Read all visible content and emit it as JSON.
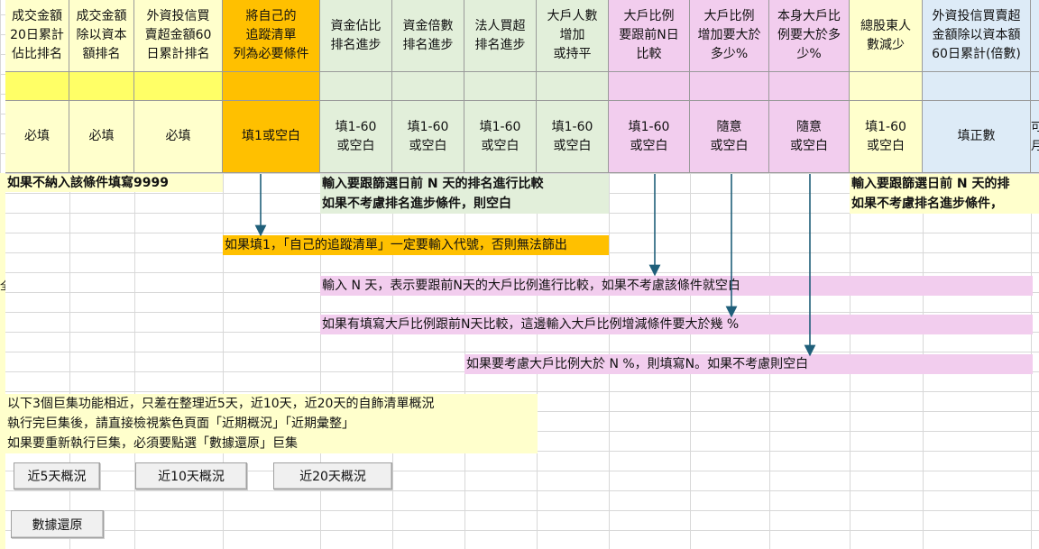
{
  "colors": {
    "yellow": "#ffff66",
    "yellow_light": "#ffffcc",
    "orange": "#ffc000",
    "green": "#e2efda",
    "pink": "#f2cdee",
    "blue": "#ddebf7",
    "arrow": "#1f5f7a"
  },
  "headers": [
    {
      "id": "h1",
      "title": "成交金額\n20日累計\n佔比排名",
      "req": "必填"
    },
    {
      "id": "h2",
      "title": "成交金額\n除以資本\n額排名",
      "req": "必填"
    },
    {
      "id": "h3",
      "title": "外資投信買\n賣超金額60\n日累計排名",
      "req": "必填"
    },
    {
      "id": "h4",
      "title": "將自己的\n追蹤清單\n列為必要條件",
      "req": "填1或空白"
    },
    {
      "id": "h5",
      "title": "資金佔比\n排名進步",
      "req": "填1-60\n或空白"
    },
    {
      "id": "h6",
      "title": "資金倍數\n排名進步",
      "req": "填1-60\n或空白"
    },
    {
      "id": "h7",
      "title": "法人買超\n排名進步",
      "req": "填1-60\n或空白"
    },
    {
      "id": "h8",
      "title": "大戶人數\n增加\n或持平",
      "req": "填1-60\n或空白"
    },
    {
      "id": "h9",
      "title": "大戶比例\n要跟前N日\n比較",
      "req": "填1-60\n或空白"
    },
    {
      "id": "h10",
      "title": "大戶比例\n增加要大於\n多少%",
      "req": "隨意\n或空白"
    },
    {
      "id": "h11",
      "title": "本身大戶比\n例要大於多\n少%",
      "req": "隨意\n或空白"
    },
    {
      "id": "h12",
      "title": "總股東人\n數減少",
      "req": "填1-60\n或空白"
    },
    {
      "id": "h13",
      "title": "外資投信買賣超\n金額除以資本額\n60日累計(倍數)",
      "req": "填正數"
    },
    {
      "id": "h14",
      "title": "",
      "req": "可\n月"
    }
  ],
  "notes": {
    "n1": "如果不納入該條件填寫9999",
    "n2a": "輸入要跟篩選日前 N 天的排名進行比較",
    "n2b": "如果不考慮排名進步條件，則空白",
    "n3a": "輸入要跟篩選日前 N 天的排",
    "n3b": "如果不考慮排名進步條件，",
    "n4": "如果填1，「自己的追蹤清單」一定要輸入代號，否則無法篩出",
    "n5": "輸入 N 天，表示要跟前N天的大戶比例進行比較，如果不考慮該條件就空白",
    "n6": "如果有填寫大戶比例跟前N天比較，這邊輸入大戶比例增減條件要大於幾 %",
    "n7": "如果要考慮大戶比例大於 N %，則填寫N。如果不考慮則空白",
    "n8a": "以下3個巨集功能相近，只差在整理近5天，近10天，近20天的自飾清單概況",
    "n8b": "執行完巨集後，請直接檢視紫色頁面「近期概況」「近期彙整」",
    "n8c": "如果要重新執行巨集，必須要點選「數據還原」巨集",
    "edge_mark": "全"
  },
  "buttons": {
    "b5": "近5天概況",
    "b10": "近10天概況",
    "b20": "近20天概況",
    "restore": "數據還原"
  }
}
